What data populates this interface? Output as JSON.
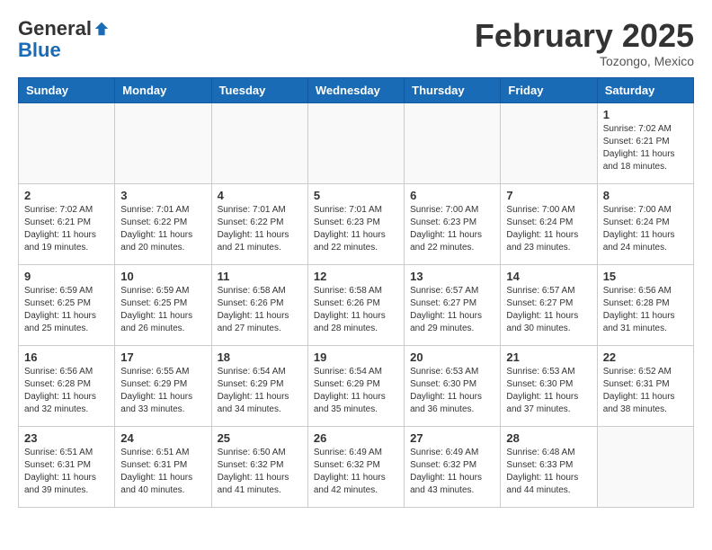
{
  "header": {
    "logo_general": "General",
    "logo_blue": "Blue",
    "month": "February 2025",
    "location": "Tozongo, Mexico"
  },
  "days_of_week": [
    "Sunday",
    "Monday",
    "Tuesday",
    "Wednesday",
    "Thursday",
    "Friday",
    "Saturday"
  ],
  "weeks": [
    [
      {
        "day": "",
        "info": ""
      },
      {
        "day": "",
        "info": ""
      },
      {
        "day": "",
        "info": ""
      },
      {
        "day": "",
        "info": ""
      },
      {
        "day": "",
        "info": ""
      },
      {
        "day": "",
        "info": ""
      },
      {
        "day": "1",
        "info": "Sunrise: 7:02 AM\nSunset: 6:21 PM\nDaylight: 11 hours and 18 minutes."
      }
    ],
    [
      {
        "day": "2",
        "info": "Sunrise: 7:02 AM\nSunset: 6:21 PM\nDaylight: 11 hours and 19 minutes."
      },
      {
        "day": "3",
        "info": "Sunrise: 7:01 AM\nSunset: 6:22 PM\nDaylight: 11 hours and 20 minutes."
      },
      {
        "day": "4",
        "info": "Sunrise: 7:01 AM\nSunset: 6:22 PM\nDaylight: 11 hours and 21 minutes."
      },
      {
        "day": "5",
        "info": "Sunrise: 7:01 AM\nSunset: 6:23 PM\nDaylight: 11 hours and 22 minutes."
      },
      {
        "day": "6",
        "info": "Sunrise: 7:00 AM\nSunset: 6:23 PM\nDaylight: 11 hours and 22 minutes."
      },
      {
        "day": "7",
        "info": "Sunrise: 7:00 AM\nSunset: 6:24 PM\nDaylight: 11 hours and 23 minutes."
      },
      {
        "day": "8",
        "info": "Sunrise: 7:00 AM\nSunset: 6:24 PM\nDaylight: 11 hours and 24 minutes."
      }
    ],
    [
      {
        "day": "9",
        "info": "Sunrise: 6:59 AM\nSunset: 6:25 PM\nDaylight: 11 hours and 25 minutes."
      },
      {
        "day": "10",
        "info": "Sunrise: 6:59 AM\nSunset: 6:25 PM\nDaylight: 11 hours and 26 minutes."
      },
      {
        "day": "11",
        "info": "Sunrise: 6:58 AM\nSunset: 6:26 PM\nDaylight: 11 hours and 27 minutes."
      },
      {
        "day": "12",
        "info": "Sunrise: 6:58 AM\nSunset: 6:26 PM\nDaylight: 11 hours and 28 minutes."
      },
      {
        "day": "13",
        "info": "Sunrise: 6:57 AM\nSunset: 6:27 PM\nDaylight: 11 hours and 29 minutes."
      },
      {
        "day": "14",
        "info": "Sunrise: 6:57 AM\nSunset: 6:27 PM\nDaylight: 11 hours and 30 minutes."
      },
      {
        "day": "15",
        "info": "Sunrise: 6:56 AM\nSunset: 6:28 PM\nDaylight: 11 hours and 31 minutes."
      }
    ],
    [
      {
        "day": "16",
        "info": "Sunrise: 6:56 AM\nSunset: 6:28 PM\nDaylight: 11 hours and 32 minutes."
      },
      {
        "day": "17",
        "info": "Sunrise: 6:55 AM\nSunset: 6:29 PM\nDaylight: 11 hours and 33 minutes."
      },
      {
        "day": "18",
        "info": "Sunrise: 6:54 AM\nSunset: 6:29 PM\nDaylight: 11 hours and 34 minutes."
      },
      {
        "day": "19",
        "info": "Sunrise: 6:54 AM\nSunset: 6:29 PM\nDaylight: 11 hours and 35 minutes."
      },
      {
        "day": "20",
        "info": "Sunrise: 6:53 AM\nSunset: 6:30 PM\nDaylight: 11 hours and 36 minutes."
      },
      {
        "day": "21",
        "info": "Sunrise: 6:53 AM\nSunset: 6:30 PM\nDaylight: 11 hours and 37 minutes."
      },
      {
        "day": "22",
        "info": "Sunrise: 6:52 AM\nSunset: 6:31 PM\nDaylight: 11 hours and 38 minutes."
      }
    ],
    [
      {
        "day": "23",
        "info": "Sunrise: 6:51 AM\nSunset: 6:31 PM\nDaylight: 11 hours and 39 minutes."
      },
      {
        "day": "24",
        "info": "Sunrise: 6:51 AM\nSunset: 6:31 PM\nDaylight: 11 hours and 40 minutes."
      },
      {
        "day": "25",
        "info": "Sunrise: 6:50 AM\nSunset: 6:32 PM\nDaylight: 11 hours and 41 minutes."
      },
      {
        "day": "26",
        "info": "Sunrise: 6:49 AM\nSunset: 6:32 PM\nDaylight: 11 hours and 42 minutes."
      },
      {
        "day": "27",
        "info": "Sunrise: 6:49 AM\nSunset: 6:32 PM\nDaylight: 11 hours and 43 minutes."
      },
      {
        "day": "28",
        "info": "Sunrise: 6:48 AM\nSunset: 6:33 PM\nDaylight: 11 hours and 44 minutes."
      },
      {
        "day": "",
        "info": ""
      }
    ]
  ]
}
